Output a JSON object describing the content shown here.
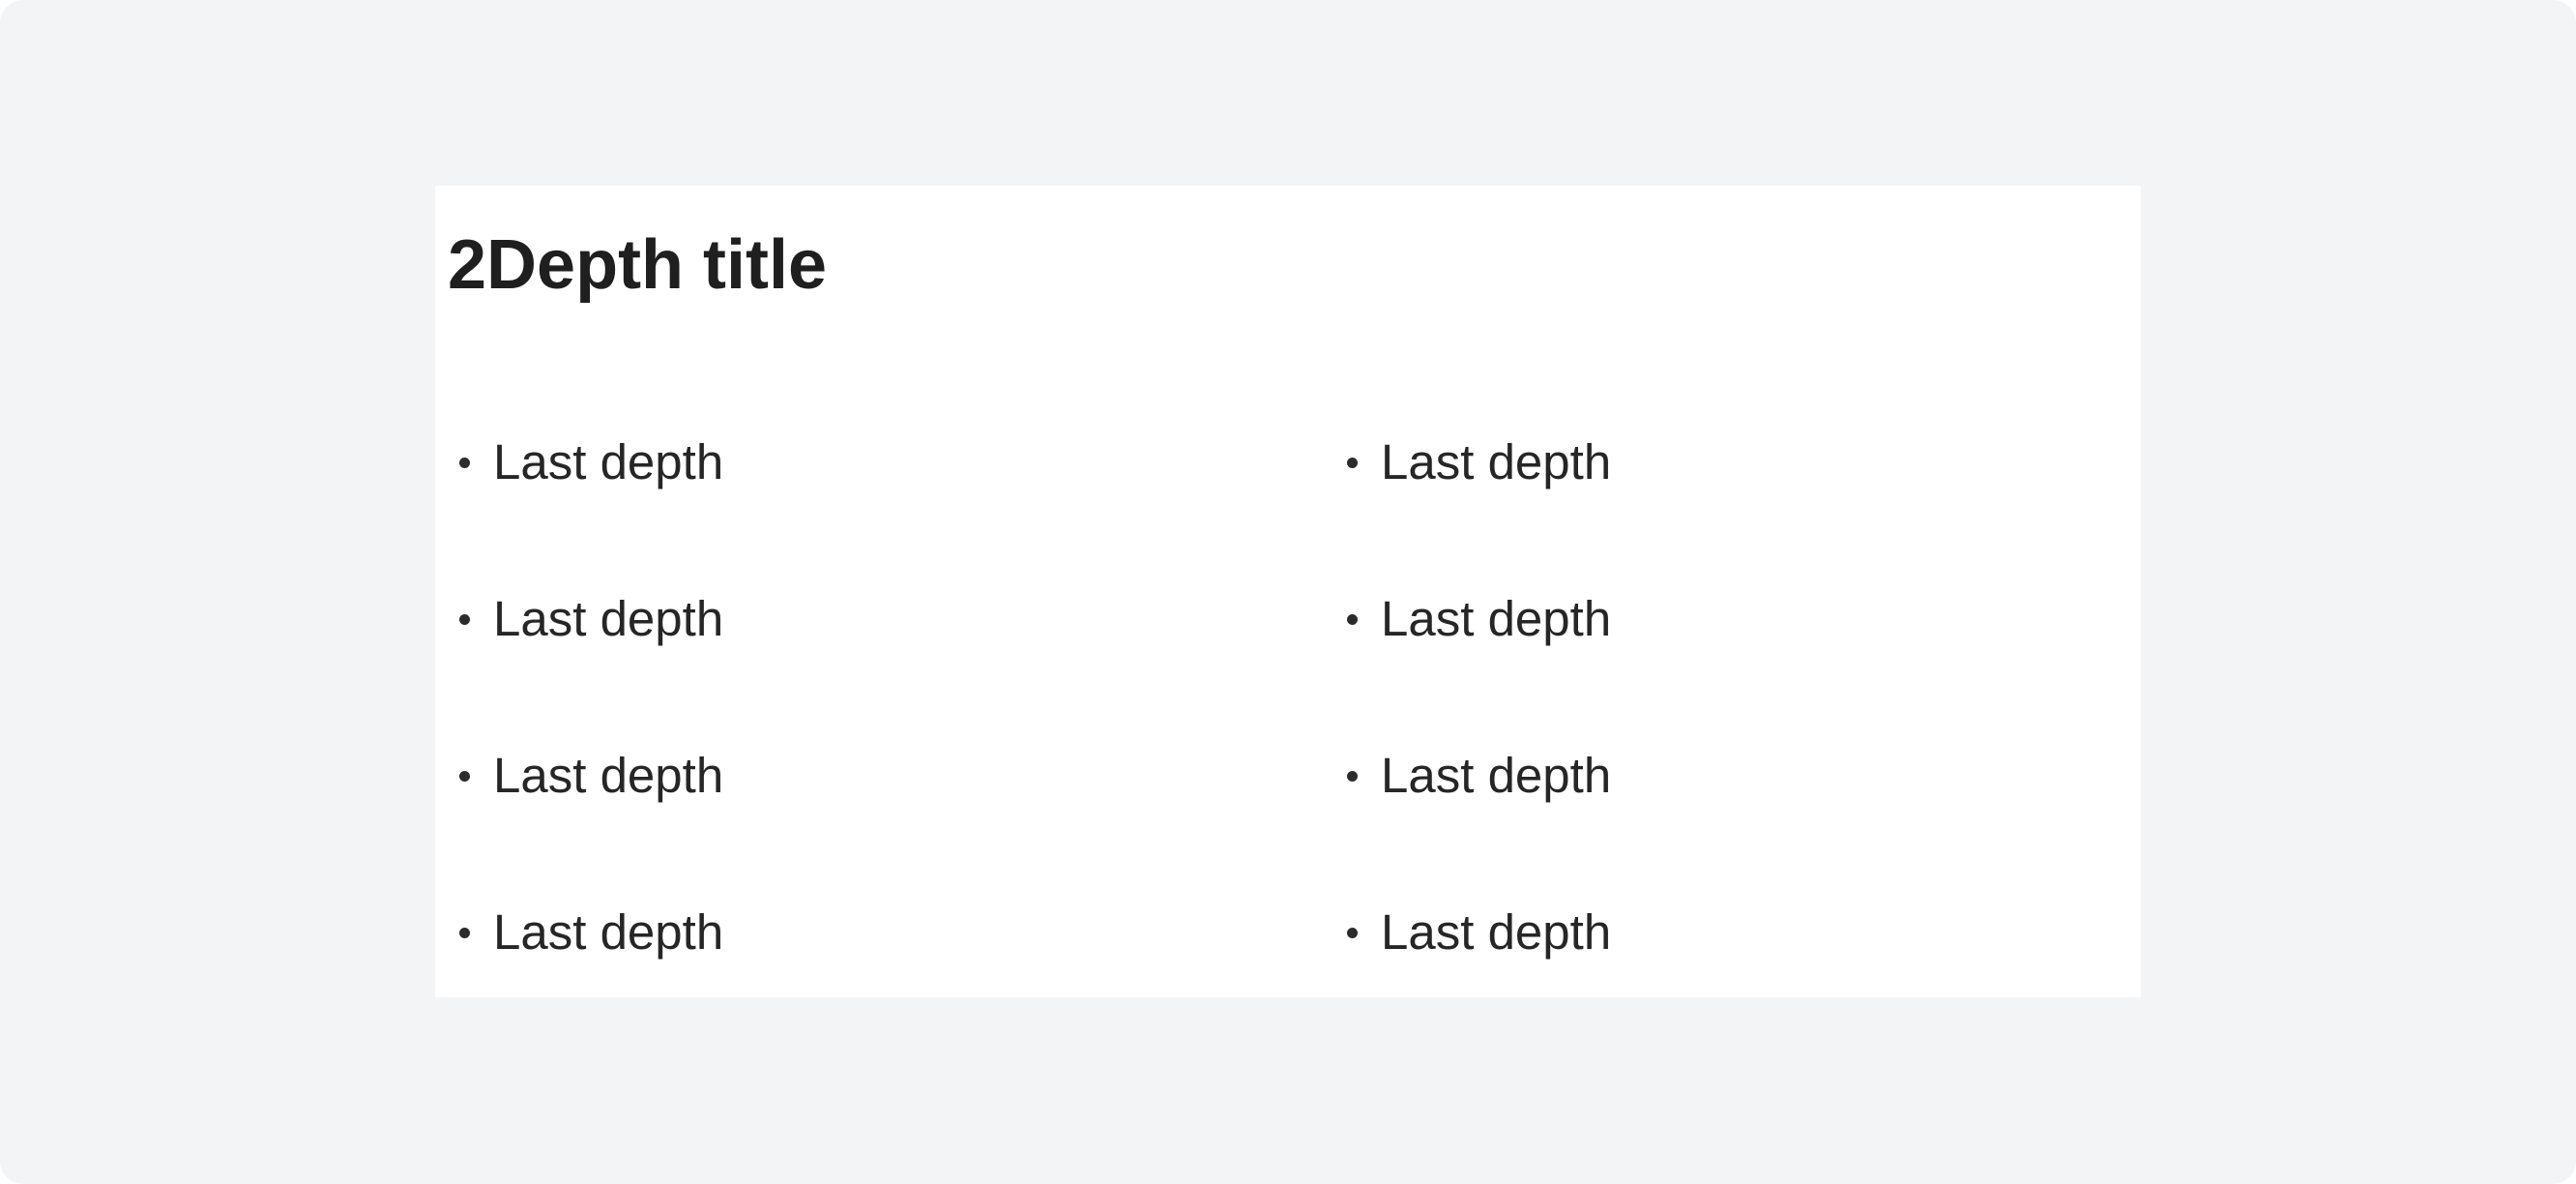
{
  "section": {
    "title": "2Depth title",
    "columns": [
      {
        "items": [
          {
            "label": "Last depth"
          },
          {
            "label": "Last depth"
          },
          {
            "label": "Last depth"
          },
          {
            "label": "Last depth"
          }
        ]
      },
      {
        "items": [
          {
            "label": "Last depth"
          },
          {
            "label": "Last depth"
          },
          {
            "label": "Last depth"
          },
          {
            "label": "Last depth"
          }
        ]
      }
    ]
  }
}
